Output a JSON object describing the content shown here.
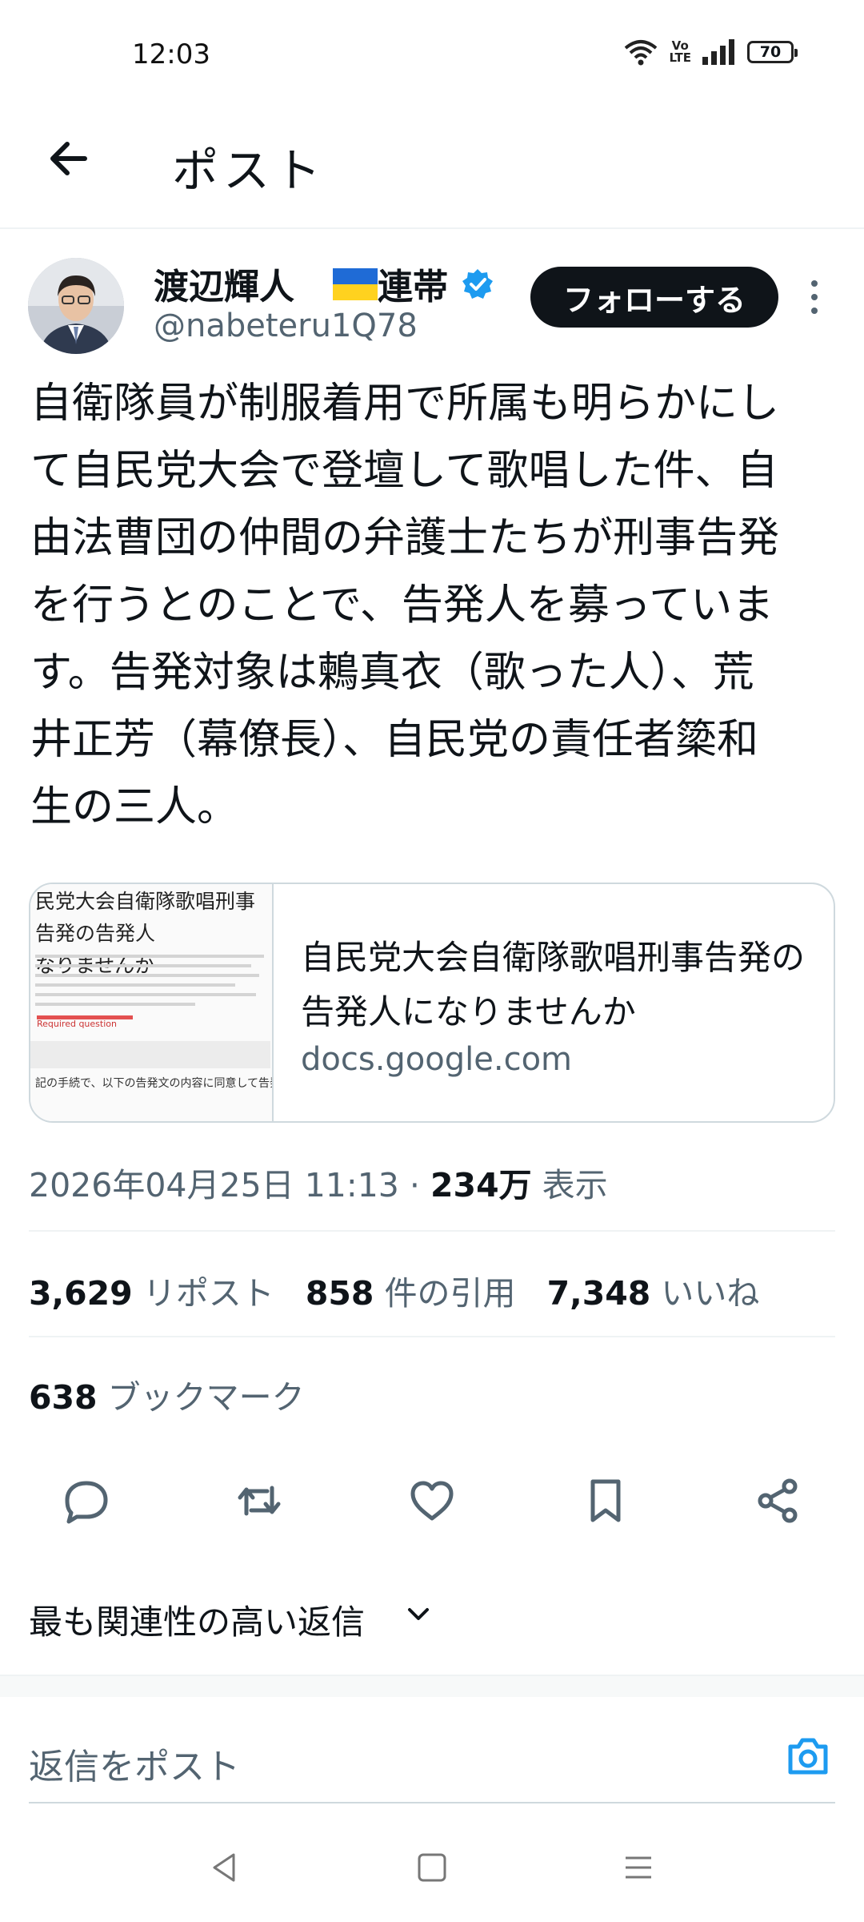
{
  "status_bar": {
    "time": "12:03",
    "volte": "Vo\nLTE",
    "battery": "70",
    "icons": [
      "wifi-icon",
      "volte-icon",
      "signal-icon",
      "battery-icon"
    ]
  },
  "header": {
    "title": "ポスト",
    "back_icon": "arrow-left-icon"
  },
  "author": {
    "name": "渡辺輝人",
    "suffix": "連帯",
    "flag": "ukraine-flag-icon",
    "verified_icon": "verified-badge-icon",
    "handle": "@nabeteru1Q78",
    "follow_label": "フォローする"
  },
  "tweet": {
    "text": "自衛隊員が制服着用で所属も明らかにし\nて自民党大会で登壇して歌唱した件、自\n由法曹団の仲間の弁護士たちが刑事告発\nを行うとのことで、告発人を募っていま\nす。告発対象は鶫真衣（歌った人）、荒\n井正芳（幕僚長）、自民党の責任者簗和\n生の三人。"
  },
  "link_card": {
    "thumb_title": "民党大会自衛隊歌唱刑事告発の告発人\nなりませんか",
    "thumb_red_text": "Required question",
    "thumb_bottom_text": "記の手続で、以下の告発文の内容に同意して告発人になって頂けるでしょう",
    "title": "自民党大会自衛隊歌唱刑事告発の告発人になりませんか",
    "domain": "docs.google.com"
  },
  "meta": {
    "datetime": "2026年04月25日 11:13",
    "separator": "·",
    "views": "234万",
    "views_label": "表示"
  },
  "stats": {
    "reposts": "3,629",
    "reposts_label": "リポスト",
    "quotes": "858",
    "quotes_label": "件の引用",
    "likes": "7,348",
    "likes_label": "いいね",
    "bookmarks": "638",
    "bookmarks_label": "ブックマーク"
  },
  "actions": [
    "reply-icon",
    "repost-icon",
    "like-icon",
    "bookmark-icon",
    "share-icon"
  ],
  "replies": {
    "sort_label": "最も関連性の高い返信",
    "chevron_icon": "chevron-down-icon"
  },
  "composer": {
    "placeholder": "返信をポスト",
    "camera_icon": "camera-icon"
  },
  "nav_bar": [
    "nav-back-icon",
    "nav-home-icon",
    "nav-menu-icon"
  ],
  "colors": {
    "accent": "#1d9bf0",
    "text": "#0f1419",
    "secondary": "#536471",
    "border": "#cfd9de"
  }
}
